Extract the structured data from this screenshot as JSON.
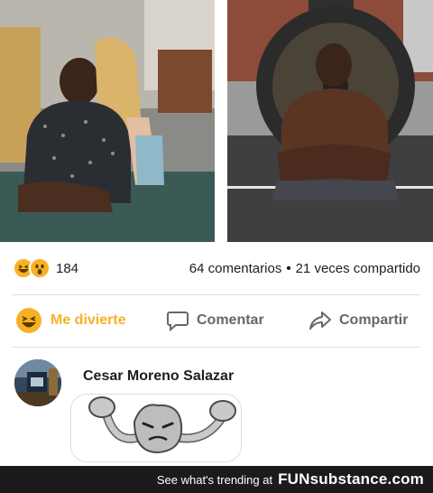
{
  "post": {
    "reaction_count": "184",
    "comments_text": "64 comentarios",
    "separator": "•",
    "shares_text": "21 veces compartido"
  },
  "actions": {
    "like_label": "Me divierte",
    "comment_label": "Comentar",
    "share_label": "Compartir"
  },
  "comment": {
    "author": "Cesar Moreno Salazar"
  },
  "footer": {
    "trending_text": "See what's trending at",
    "brand": "FUNsubstance.com"
  },
  "colors": {
    "reaction_yellow": "#f7b125",
    "action_gray": "#65676b",
    "footer_bg": "#1b1b1b"
  },
  "icons": [
    "haha-emoji-icon",
    "wow-emoji-icon",
    "comment-bubble-icon",
    "share-arrow-icon",
    "avatar-photo",
    "geodude-sticker"
  ]
}
